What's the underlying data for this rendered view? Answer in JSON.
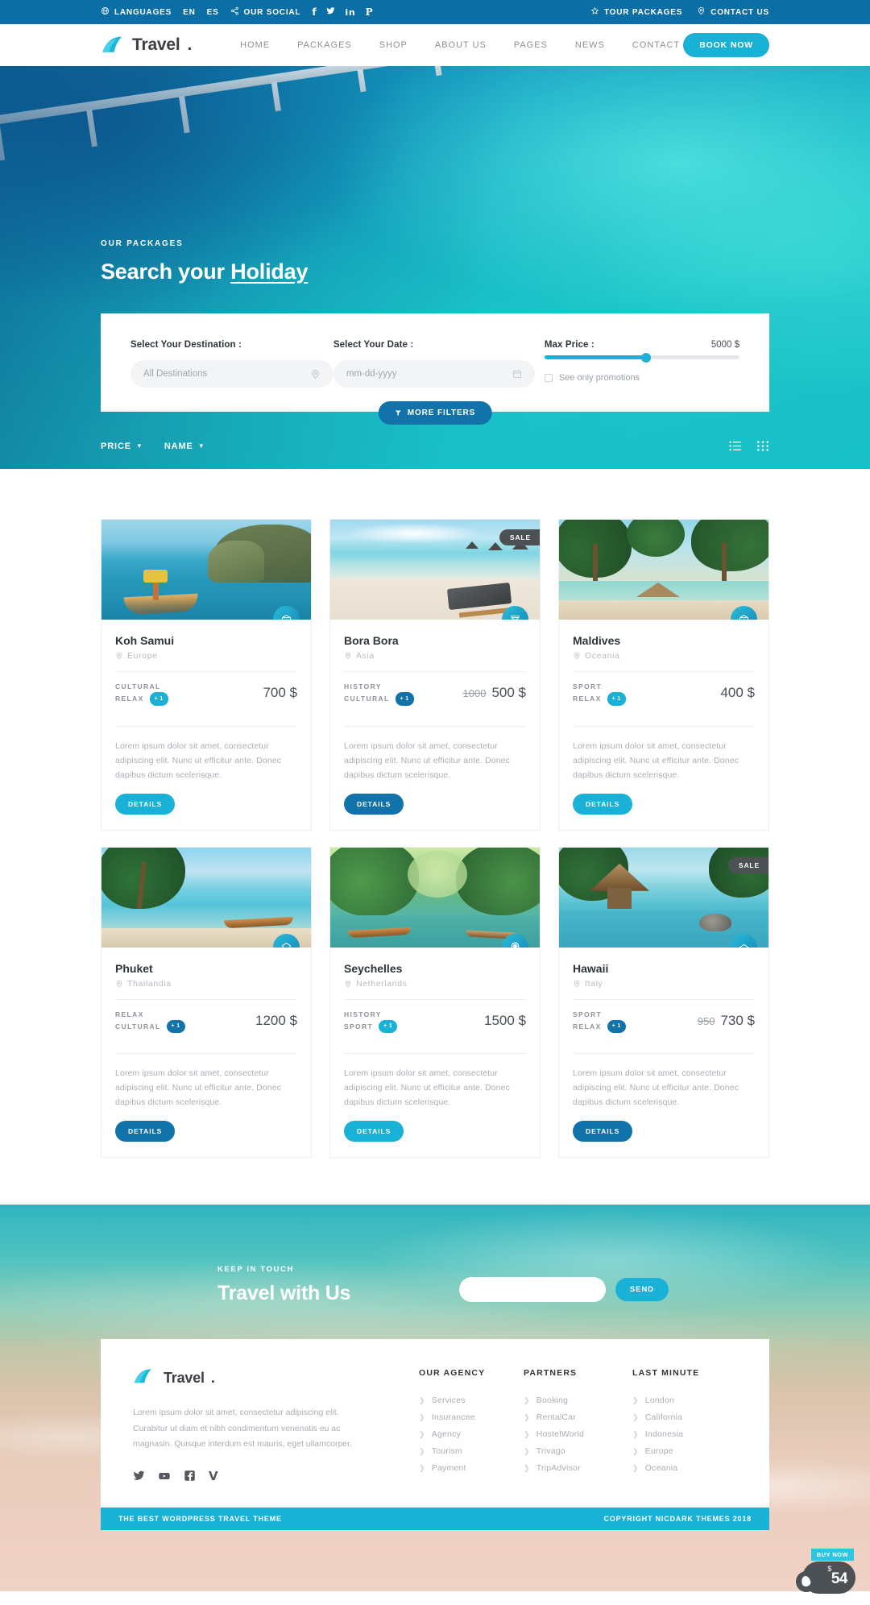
{
  "topbar": {
    "languages_label": "LANGUAGES",
    "lang_en": "EN",
    "lang_es": "ES",
    "social_label": "OUR SOCIAL",
    "socials": [
      "facebook-icon",
      "twitter-icon",
      "linkedin-icon",
      "pinterest-icon"
    ],
    "tour_packages": "TOUR PACKAGES",
    "contact_us": "CONTACT US"
  },
  "nav": {
    "brand": "Travel",
    "brand_dot": ".",
    "links": [
      "HOME",
      "PACKAGES",
      "SHOP",
      "ABOUT US",
      "PAGES",
      "NEWS",
      "CONTACT"
    ],
    "book_now": "BOOK NOW"
  },
  "hero": {
    "kicker": "OUR PACKAGES",
    "title_plain": "Search your ",
    "title_underlined": "Holiday"
  },
  "search": {
    "destination_label": "Select Your Destination :",
    "destination_placeholder": "All Destinations",
    "date_label": "Select Your Date :",
    "date_placeholder": "mm-dd-yyyy",
    "price_label": "Max Price :",
    "price_value": "5000 $",
    "slider_percent": 52,
    "promotions_label": "See only promotions",
    "promotions_checked": false,
    "more_filters": "MORE FILTERS"
  },
  "sortbar": {
    "sort_price": "PRICE",
    "sort_name": "NAME",
    "view_list": "list-view-icon",
    "view_grid": "grid-view-icon"
  },
  "cards": [
    {
      "title": "Koh Samui",
      "location": "Europe",
      "tags": [
        "CULTURAL",
        "RELAX"
      ],
      "extra_tags": "+ 1",
      "old_price": "",
      "price": "700 $",
      "sale": false,
      "desc": "Lorem ipsum dolor sit amet, consectetur adipiscing elit. Nunc ut efficitur ante. Donec dapibus dictum scelerisque.",
      "button": "DETAILS",
      "icon": "monument-icon",
      "theme": "light"
    },
    {
      "title": "Bora Bora",
      "location": "Asia",
      "tags": [
        "HISTORY",
        "CULTURAL"
      ],
      "extra_tags": "+ 1",
      "old_price": "1000",
      "price": "500 $",
      "sale": true,
      "sale_label": "SALE",
      "desc": "Lorem ipsum dolor sit amet, consectetur adipiscing elit. Nunc ut efficitur ante. Donec dapibus dictum scelerisque.",
      "button": "DETAILS",
      "icon": "torii-gate-icon",
      "theme": "dark"
    },
    {
      "title": "Maldives",
      "location": "Oceania",
      "tags": [
        "SPORT",
        "RELAX"
      ],
      "extra_tags": "+ 1",
      "old_price": "",
      "price": "400 $",
      "sale": false,
      "desc": "Lorem ipsum dolor sit amet, consectetur adipiscing elit. Nunc ut efficitur ante. Donec dapibus dictum scelerisque.",
      "button": "DETAILS",
      "icon": "monument-icon",
      "theme": "light"
    },
    {
      "title": "Phuket",
      "location": "Thailandia",
      "tags": [
        "RELAX",
        "CULTURAL"
      ],
      "extra_tags": "+ 1",
      "old_price": "",
      "price": "1200 $",
      "sale": false,
      "desc": "Lorem ipsum dolor sit amet, consectetur adipiscing elit. Nunc ut efficitur ante. Donec dapibus dictum scelerisque.",
      "button": "DETAILS",
      "icon": "temple-icon",
      "theme": "dark"
    },
    {
      "title": "Seychelles",
      "location": "Netherlands",
      "tags": [
        "HISTORY",
        "SPORT"
      ],
      "extra_tags": "+ 1",
      "old_price": "",
      "price": "1500 $",
      "sale": false,
      "desc": "Lorem ipsum dolor sit amet, consectetur adipiscing elit. Nunc ut efficitur ante. Donec dapibus dictum scelerisque.",
      "button": "DETAILS",
      "icon": "ferris-wheel-icon",
      "theme": "light"
    },
    {
      "title": "Hawaii",
      "location": "Italy",
      "tags": [
        "SPORT",
        "RELAX"
      ],
      "extra_tags": "+ 1",
      "old_price": "950",
      "price": "730 $",
      "sale": true,
      "sale_label": "SALE",
      "desc": "Lorem ipsum dolor sit amet, consectetur adipiscing elit. Nunc ut efficitur ante. Donec dapibus dictum scelerisque.",
      "button": "DETAILS",
      "icon": "monument-icon",
      "theme": "dark"
    }
  ],
  "newsletter": {
    "kicker": "KEEP IN TOUCH",
    "title": "Travel with Us",
    "input_value": "",
    "input_placeholder": "",
    "send": "SEND"
  },
  "footer": {
    "brand": "Travel",
    "brand_dot": ".",
    "description": "Lorem ipsum dolor sit amet, consectetur adipiscing elit. Curabitur ut diam et nibh condimentum venenatis eu ac magnasin. Quisque interdum est mauris, eget ullamcorper.",
    "socials": [
      "twitter-icon",
      "youtube-icon",
      "facebook-icon",
      "vimeo-icon"
    ],
    "columns": [
      {
        "title": "OUR AGENCY",
        "items": [
          "Services",
          "Insurancee",
          "Agency",
          "Tourism",
          "Payment"
        ]
      },
      {
        "title": "PARTNERS",
        "items": [
          "Booking",
          "RentalCar",
          "HostelWorld",
          "Trivago",
          "TripAdvisor"
        ]
      },
      {
        "title": "LAST MINUTE",
        "items": [
          "London",
          "California",
          "Indonesia",
          "Europe",
          "Oceania"
        ]
      }
    ],
    "bar_left": "THE BEST WORDPRESS TRAVEL THEME",
    "bar_right": "COPYRIGHT NICDARK THEMES 2018"
  },
  "floating_widget": {
    "tag": "BUY NOW",
    "currency": "$",
    "price": "54"
  },
  "colors": {
    "topbar_blue": "#0b6ea4",
    "accent_cyan": "#19b1d6",
    "deep_blue": "#1273ab",
    "text_dark": "#2f343a",
    "text_muted": "#a9aeb4"
  }
}
